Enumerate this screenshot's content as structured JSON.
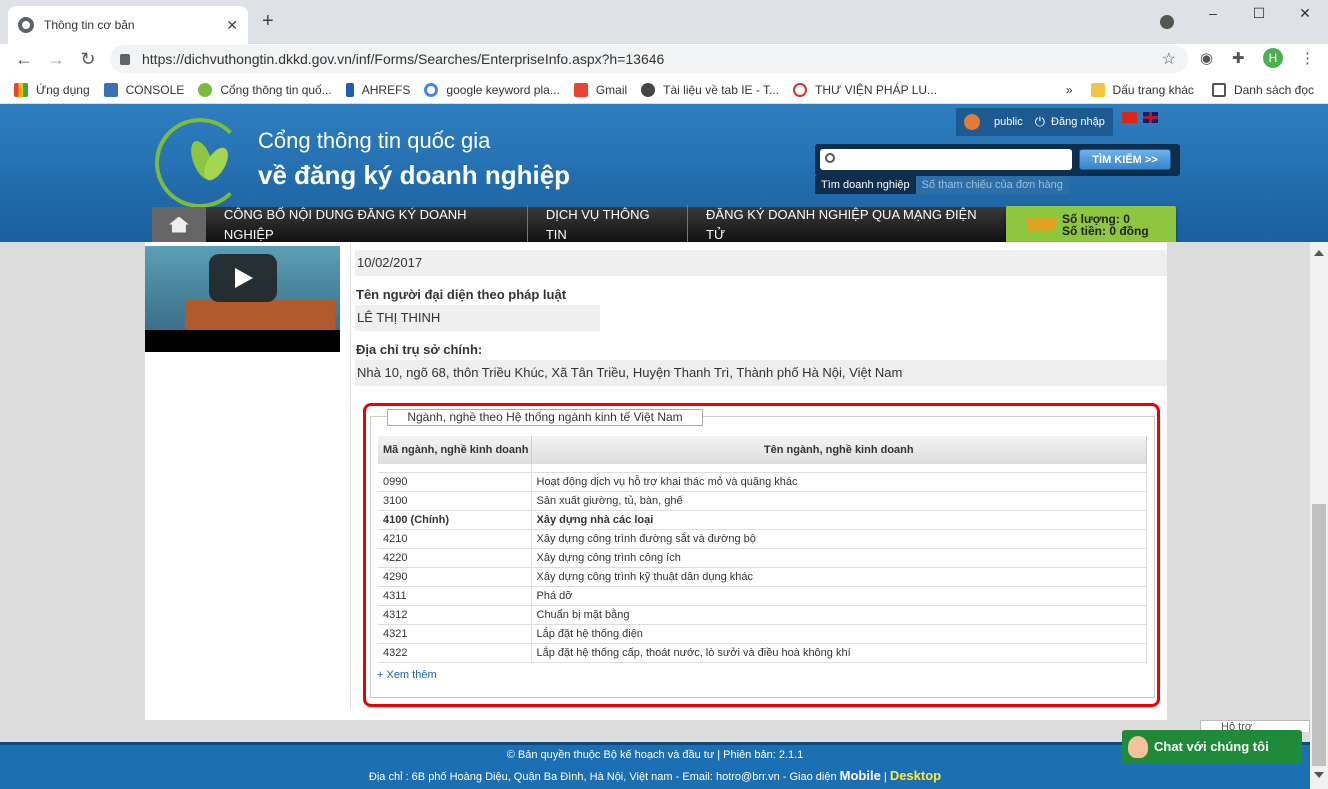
{
  "browser": {
    "tab_title": "Thông tin cơ bản",
    "url": "https://dichvuthongtin.dkkd.gov.vn/inf/Forms/Searches/EnterpriseInfo.aspx?h=13646",
    "avatar_letter": "H",
    "bookmarks": [
      "Ứng dụng",
      "CONSOLE",
      "Cổng thông tin quố...",
      "AHREFS",
      "google keyword pla...",
      "Gmail",
      "Tài liệu về tab IE - T...",
      "THƯ VIỆN PHÁP LU..."
    ],
    "bookmarks_overflow": "»",
    "other_bookmarks": "Dấu trang khác",
    "reading_list": "Danh sách đọc"
  },
  "site": {
    "title_line1": "Cổng thông tin quốc gia",
    "title_line2": "về đăng ký doanh nghiệp",
    "user": "public",
    "login": "Đăng nhập",
    "search_button": "TÌM KIẾM >>",
    "search_tab_active": "Tìm doanh nghiệp",
    "search_tab_inactive": "Số tham chiếu của đơn hàng",
    "nav": [
      "CÔNG BỐ NỘI DUNG ĐĂNG KÝ DOANH NGHIỆP",
      "DỊCH VỤ THÔNG TIN",
      "ĐĂNG KÝ DOANH NGHIỆP QUA MẠNG ĐIỆN TỬ"
    ],
    "cart_qty": "Số lượng: 0",
    "cart_total": "Số tiền: 0 đồng"
  },
  "company": {
    "date_value": "10/02/2017",
    "rep_label": "Tên người đại diện theo pháp luật",
    "rep_value": "LÊ THỊ THINH",
    "address_label": "Địa chỉ trụ sở chính:",
    "address_value": "Nhà 10, ngõ 68, thôn Triều Khúc, Xã Tân Triều, Huyện Thanh Trì, Thành phố Hà Nội, Việt Nam"
  },
  "industry": {
    "legend": "Ngành, nghề theo Hệ thống ngành kinh tế Việt Nam",
    "col_code": "Mã ngành, nghề kinh doanh",
    "col_name": "Tên ngành, nghề kinh doanh",
    "rows": [
      {
        "code": "0990",
        "name": "Hoạt động dịch vụ hỗ trợ khai thác mỏ và quặng khác"
      },
      {
        "code": "3100",
        "name": "Sản xuất giường, tủ, bàn, ghế"
      },
      {
        "code": "4100 (Chính)",
        "name": "Xây dựng nhà các loại"
      },
      {
        "code": "4210",
        "name": "Xây dựng công trình đường sắt và đường bộ"
      },
      {
        "code": "4220",
        "name": "Xây dựng công trình công ích"
      },
      {
        "code": "4290",
        "name": "Xây dựng công trình kỹ thuật dân dụng khác"
      },
      {
        "code": "4311",
        "name": "Phá dỡ"
      },
      {
        "code": "4312",
        "name": "Chuẩn bị mặt bằng"
      },
      {
        "code": "4321",
        "name": "Lắp đặt hệ thống điện"
      },
      {
        "code": "4322",
        "name": "Lắp đặt hệ thống cấp, thoát nước, lò sưởi và điều hoà không khí"
      }
    ],
    "more": "+ Xem thêm"
  },
  "footer": {
    "line1": "© Bản quyền thuộc Bộ kế hoạch và đầu tư | Phiên bản: 2.1.1",
    "line2": "Địa chỉ : 6B phố Hoàng Diệu, Quận Ba Đình, Hà Nội, Việt nam - Email: hotro@brr.vn - Giao diện",
    "mobile": "Mobile",
    "sep": "|",
    "desktop": "Desktop",
    "chat": "Chat với chúng tôi",
    "minibox": "Hỗ trợ"
  }
}
